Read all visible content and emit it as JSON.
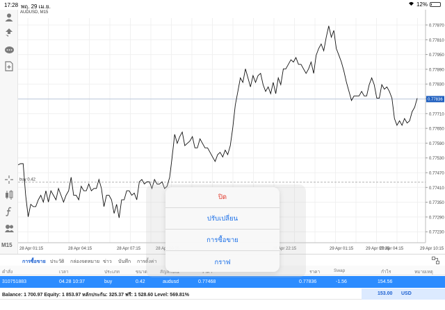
{
  "status_bar": {
    "time": "17:28",
    "date": "พฤ. 29 เม.ย.",
    "battery": "12%",
    "battery_fraction": 0.12
  },
  "chart": {
    "symbol": "AUDUSD, M15",
    "price_labels": [
      "0.77870",
      "0.77810",
      "0.77950",
      "0.77890",
      "0.77830",
      "0.77770",
      "0.77710",
      "0.77650",
      "0.77590",
      "0.77530",
      "0.77470",
      "0.77410",
      "0.77350",
      "0.77290",
      "0.77230"
    ],
    "current_price": "0.77836",
    "time_labels": [
      "28 Apr 01:15",
      "28 Apr 04:15",
      "28 Apr 07:15",
      "28 Apr 10:15",
      "28 Apr 22:15",
      "29 Apr 01:15",
      "29 Apr 04:15",
      "29 Apr 07:15",
      "29 Apr 10:15"
    ],
    "order_line_label": "buy 0.42",
    "order_price": 0.77468,
    "timeframe": "M15"
  },
  "chart_data": {
    "type": "line",
    "title": "AUDUSD, M15",
    "y": [
      0.77545,
      0.7755,
      0.7755,
      0.7741,
      0.77315,
      0.7737,
      0.7736,
      0.7736,
      0.7739,
      0.7741,
      0.7738,
      0.7743,
      0.7738,
      0.7743,
      0.7741,
      0.7739,
      0.7744,
      0.7741,
      0.7738,
      0.7741,
      0.7743,
      0.7749,
      0.7741,
      0.7741,
      0.7739,
      0.7745,
      0.7743,
      0.7743,
      0.7746,
      0.7743,
      0.7744,
      0.7744,
      0.7748,
      0.7744,
      0.7736,
      0.7741,
      0.7741,
      0.7739,
      0.7733,
      0.7737,
      0.7731,
      0.7739,
      0.7739,
      0.7743,
      0.7743,
      0.7741,
      0.7742,
      0.7739,
      0.7747,
      0.7748,
      0.7746,
      0.7747,
      0.7747,
      0.7744,
      0.7748,
      0.7746,
      0.7746,
      0.7747,
      0.7744,
      0.7745,
      0.7749,
      0.7758,
      0.7768,
      0.7764,
      0.7767,
      0.7769,
      0.7763,
      0.7764,
      0.7765,
      0.7767,
      0.7762,
      0.7762,
      0.7766,
      0.7764,
      0.7762,
      0.7762,
      0.776,
      0.7758,
      0.7756,
      0.7759,
      0.776,
      0.7758,
      0.7761,
      0.7759,
      0.7763,
      0.7771,
      0.7781,
      0.7787,
      0.7793,
      0.7791,
      0.7797,
      0.7793,
      0.7789,
      0.7794,
      0.7791,
      0.7794,
      0.7795,
      0.779,
      0.7787,
      0.7789,
      0.7786,
      0.7791,
      0.7786,
      0.7793,
      0.779,
      0.7797,
      0.7797,
      0.7799,
      0.7801,
      0.78,
      0.7802,
      0.7799,
      0.7799,
      0.7797,
      0.7795,
      0.7797,
      0.78,
      0.7795,
      0.7803,
      0.7806,
      0.7808,
      0.7805,
      0.7811,
      0.7816,
      0.7811,
      0.7814,
      0.7806,
      0.7803,
      0.78,
      0.7796,
      0.7791,
      0.7787,
      0.7783,
      0.7785,
      0.7785,
      0.7785,
      0.7787,
      0.7785,
      0.7785,
      0.779,
      0.7793,
      0.779,
      0.7784,
      0.7784,
      0.779,
      0.7788,
      0.7789,
      0.7787,
      0.7784,
      0.7775,
      0.7772,
      0.7774,
      0.7772,
      0.7775,
      0.7773,
      0.7774,
      0.7778,
      0.778,
      0.7784
    ],
    "ylim": [
      0.772,
      0.78195
    ],
    "order_line": 0.77468,
    "current_price_line": 0.77836
  },
  "toolbar": {
    "icons": [
      "account-icon",
      "trade-icon",
      "chat-icon",
      "document-icon",
      "crosshair-icon",
      "indicator-icon",
      "function-icon",
      "objects-icon"
    ]
  },
  "tabs": [
    "การซื้อขาย",
    "ประวัติ",
    "กล่องจดหมาย",
    "ข่าว",
    "บันทึก",
    "การตั้งค่า"
  ],
  "table_header": [
    "คำสั่ง",
    "เวลา",
    "ประเภท",
    "ขนาด",
    "สัญลักษณ์",
    "ราคา",
    "ราคา",
    "Swap",
    "กำไร",
    "หมายเหตุ"
  ],
  "position_row": {
    "order": "310751883",
    "time": "04.28 10:37",
    "type": "buy",
    "size": "0.42",
    "symbol": "audusd",
    "open_price": "0.77468",
    "current_price": "0.77836",
    "swap": "-1.56",
    "profit": "154.56"
  },
  "footer": {
    "balance_text": "Balance: 1 700.97 Equity: 1 853.97 หลักประกัน: 325.37 ฟรี: 1 528.60 Level: 569.81%",
    "total_profit": "153.00",
    "currency": "USD"
  },
  "context_menu": {
    "close": "ปิด",
    "modify": "ปรับเปลี่ยน",
    "trade": "การซื้อขาย",
    "chart": "กราฟ"
  },
  "colors": {
    "accent": "#2c8cff",
    "close_red": "#e23b2e",
    "link_blue": "#1a6fe8"
  }
}
